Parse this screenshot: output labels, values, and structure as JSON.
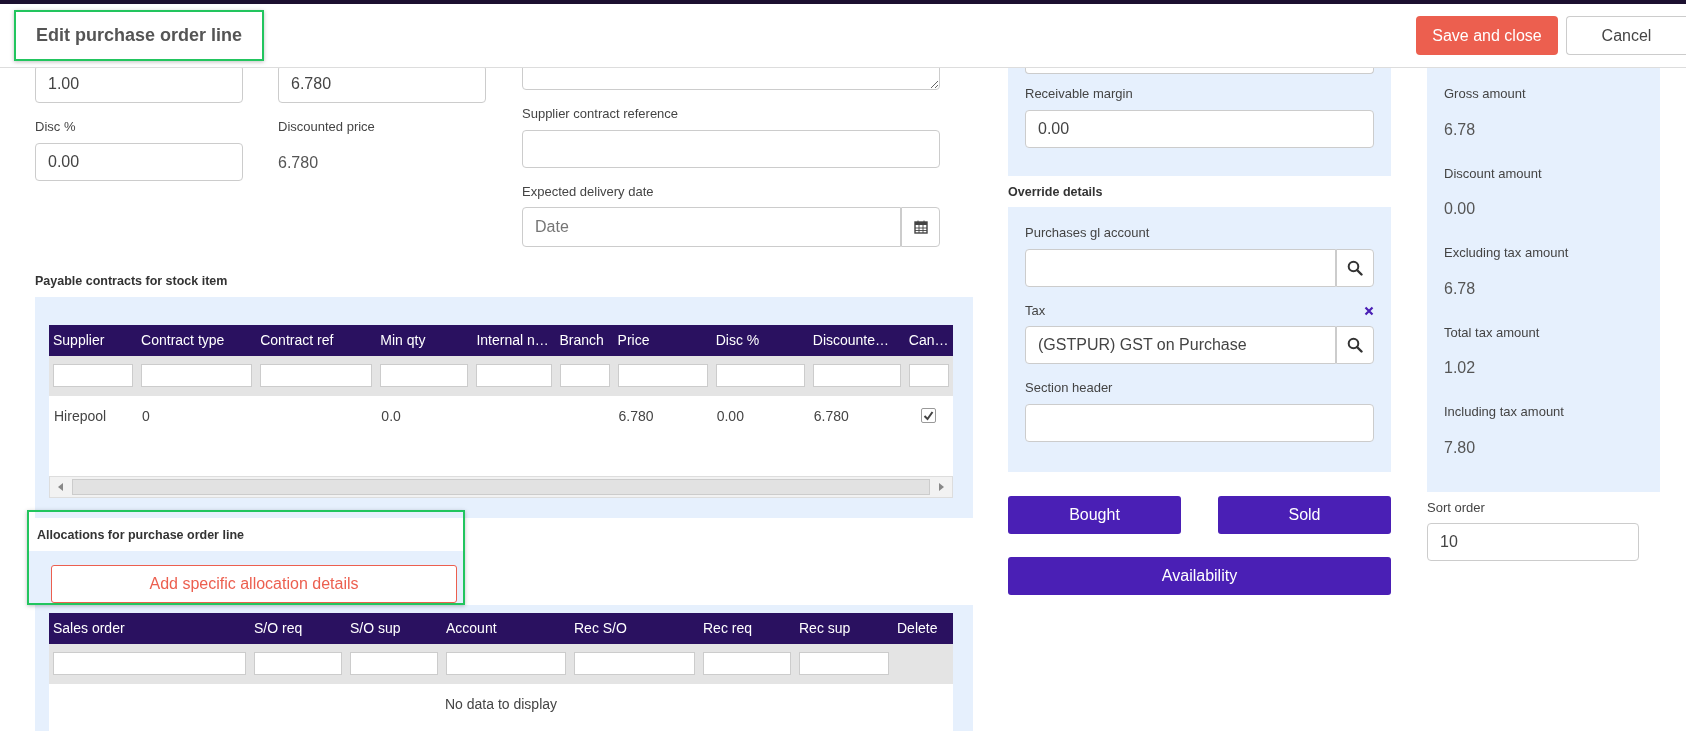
{
  "header": {
    "title": "Edit purchase order line",
    "highlighted": true,
    "buttons": [
      {
        "label": "Save and close",
        "kind": "primary"
      },
      {
        "label": "Cancel",
        "kind": "secondary"
      }
    ]
  },
  "line_fields": {
    "first_value": "1.00",
    "second_value": "6.780",
    "disc": {
      "label": "Disc %",
      "value": "0.00"
    },
    "discounted_price": {
      "label": "Discounted price",
      "value": "6.780"
    }
  },
  "supplier_contract_reference": {
    "label": "Supplier contract reference"
  },
  "expected_delivery_date": {
    "label": "Expected delivery date",
    "placeholder": "Date"
  },
  "payable_contracts": {
    "title": "Payable contracts for stock item",
    "columns": [
      "Supplier",
      "Contract type",
      "Contract ref",
      "Min qty",
      "Internal n…",
      "Branch",
      "Price",
      "Disc %",
      "Discounte…",
      "Can…"
    ],
    "rows": [
      {
        "cells": [
          "Hirepool",
          "0",
          null,
          "0.0",
          null,
          null,
          "6.780",
          "0.00",
          "6.780"
        ],
        "checked": true
      }
    ]
  },
  "allocations": {
    "title": "Allocations for purchase order line",
    "highlighted": true,
    "add_button": "Add specific allocation details",
    "columns": [
      "Sales order",
      "S/O req",
      "S/O sup",
      "Account",
      "Rec S/O",
      "Rec req",
      "Rec sup",
      "Delete"
    ],
    "empty_message": "No data to display"
  },
  "receivable_margin": {
    "label": "Receivable margin",
    "value": "0.00"
  },
  "override_details": {
    "title": "Override details",
    "purchases_gl_account": {
      "label": "Purchases gl account"
    },
    "tax": {
      "label": "Tax",
      "value": "(GSTPUR) GST on Purchase"
    },
    "section_header": {
      "label": "Section header"
    }
  },
  "actions": [
    "Bought",
    "Sold",
    "Availability"
  ],
  "totals": [
    {
      "label": "Gross amount",
      "value": "6.78"
    },
    {
      "label": "Discount amount",
      "value": "0.00"
    },
    {
      "label": "Excluding tax amount",
      "value": "6.78"
    },
    {
      "label": "Total tax amount",
      "value": "1.02"
    },
    {
      "label": "Including tax amount",
      "value": "7.80"
    }
  ],
  "sort_order": {
    "label": "Sort order",
    "value": "10"
  }
}
